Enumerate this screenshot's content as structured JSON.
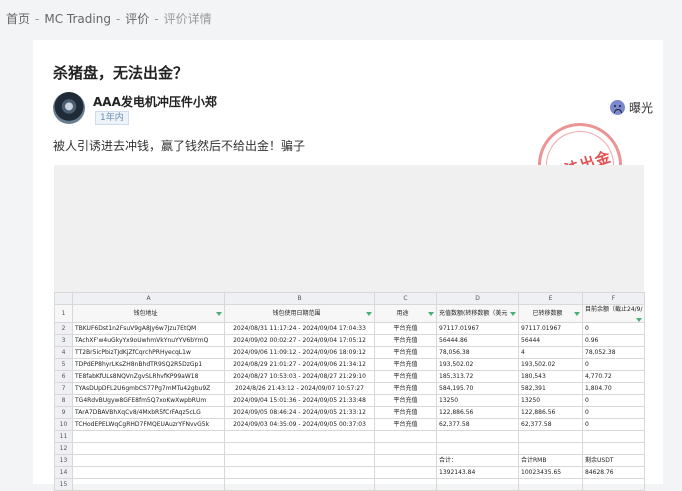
{
  "breadcrumb": {
    "home": "首页",
    "broker": "MC Trading",
    "reviews": "评价",
    "current": "评价详情"
  },
  "review": {
    "title": "杀猪盘，无法出金？",
    "author": "AAA发电机冲压件小郑",
    "years_badge": "1年内",
    "expose_label": "曝光",
    "content": "被人引诱进去冲钱，赢了钱然后不给出金！骗子",
    "stamp_text": "无法出金"
  },
  "spreadsheet": {
    "columns": [
      "A",
      "B",
      "C",
      "D",
      "E",
      "F"
    ],
    "headers": [
      "钱包地址",
      "钱包使用日期范围",
      "用途",
      "充值数额(转移数额（美元",
      "已转移数额",
      "目前余额（截止24/9/"
    ],
    "rows": [
      [
        "TBKUF6Dst1n2FsuV9gA8Jy6w7Jzu7EtQM",
        "2024/08/31 11:17:24 - 2024/09/04 17:04:33",
        "平台充值",
        "97117.01967",
        "97117.01967",
        "0"
      ],
      [
        "TAchXF'w4uGkyYx9oUwhmVkYnuYYV6bYmQ",
        "2024/09/02 00:02:27 - 2024/09/04 17:05:12",
        "平台充值",
        "56444.86",
        "56444",
        "0.96"
      ],
      [
        "TT2Br5icPbizTJdKjZfCqrchPRHyecqL1w",
        "2024/09/06 11:09:12 - 2024/09/06 18:09:12",
        "平台充值",
        "78,056.38",
        "4",
        "78,052.38"
      ],
      [
        "TDPdEP8hyrLKsZH8nBhdTR9SQ2R5DzGp1",
        "2024/08/29 21:01:27 - 2024/09/06 21:34:12",
        "平台充值",
        "193,502.02",
        "193,502.02",
        "0"
      ],
      [
        "TE8fabKfULs8NQVnZgvSLRhvfKP99aW18",
        "2024/08/27 10:53:03 - 2024/08/27 21:29:10",
        "平台充值",
        "185,313.72",
        "180,543",
        "4,770.72"
      ],
      [
        "TYAsDUpDFL2U6gmbCS77Pg7mMTu42gbu9Z",
        "2024/8/26 21:43:12 - 2024/09/07 10:57:27",
        "平台充值",
        "584,195.70",
        "582,391",
        "1,804.70"
      ],
      [
        "TG4RdvBUgyw8GFE8fm5Q7xoKwXwpbRUm",
        "2024/09/04 15:01:36 - 2024/09/05 21:33:48",
        "平台充值",
        "13250",
        "13250",
        "0"
      ],
      [
        "TArA7DBAVBhXqCv8/4MxbR5fCrFAqz5cLG",
        "2024/09/05 08:46:24 - 2024/09/05 21:33:12",
        "平台充值",
        "122,886.56",
        "122,886.56",
        "0"
      ],
      [
        "TCHodEPELWqCgRHD7FMQEUAuzrYFNvvG5k",
        "2024/09/03 04:35:09 - 2024/09/05 00:37:03",
        "平台充值",
        "62,377.58",
        "62,377.58",
        "0"
      ]
    ],
    "totals_labels": [
      "合计：",
      "合计RMB",
      "剩余USDT"
    ],
    "totals_values": [
      "1392143.84",
      "10023435.65",
      "84628.76"
    ]
  }
}
